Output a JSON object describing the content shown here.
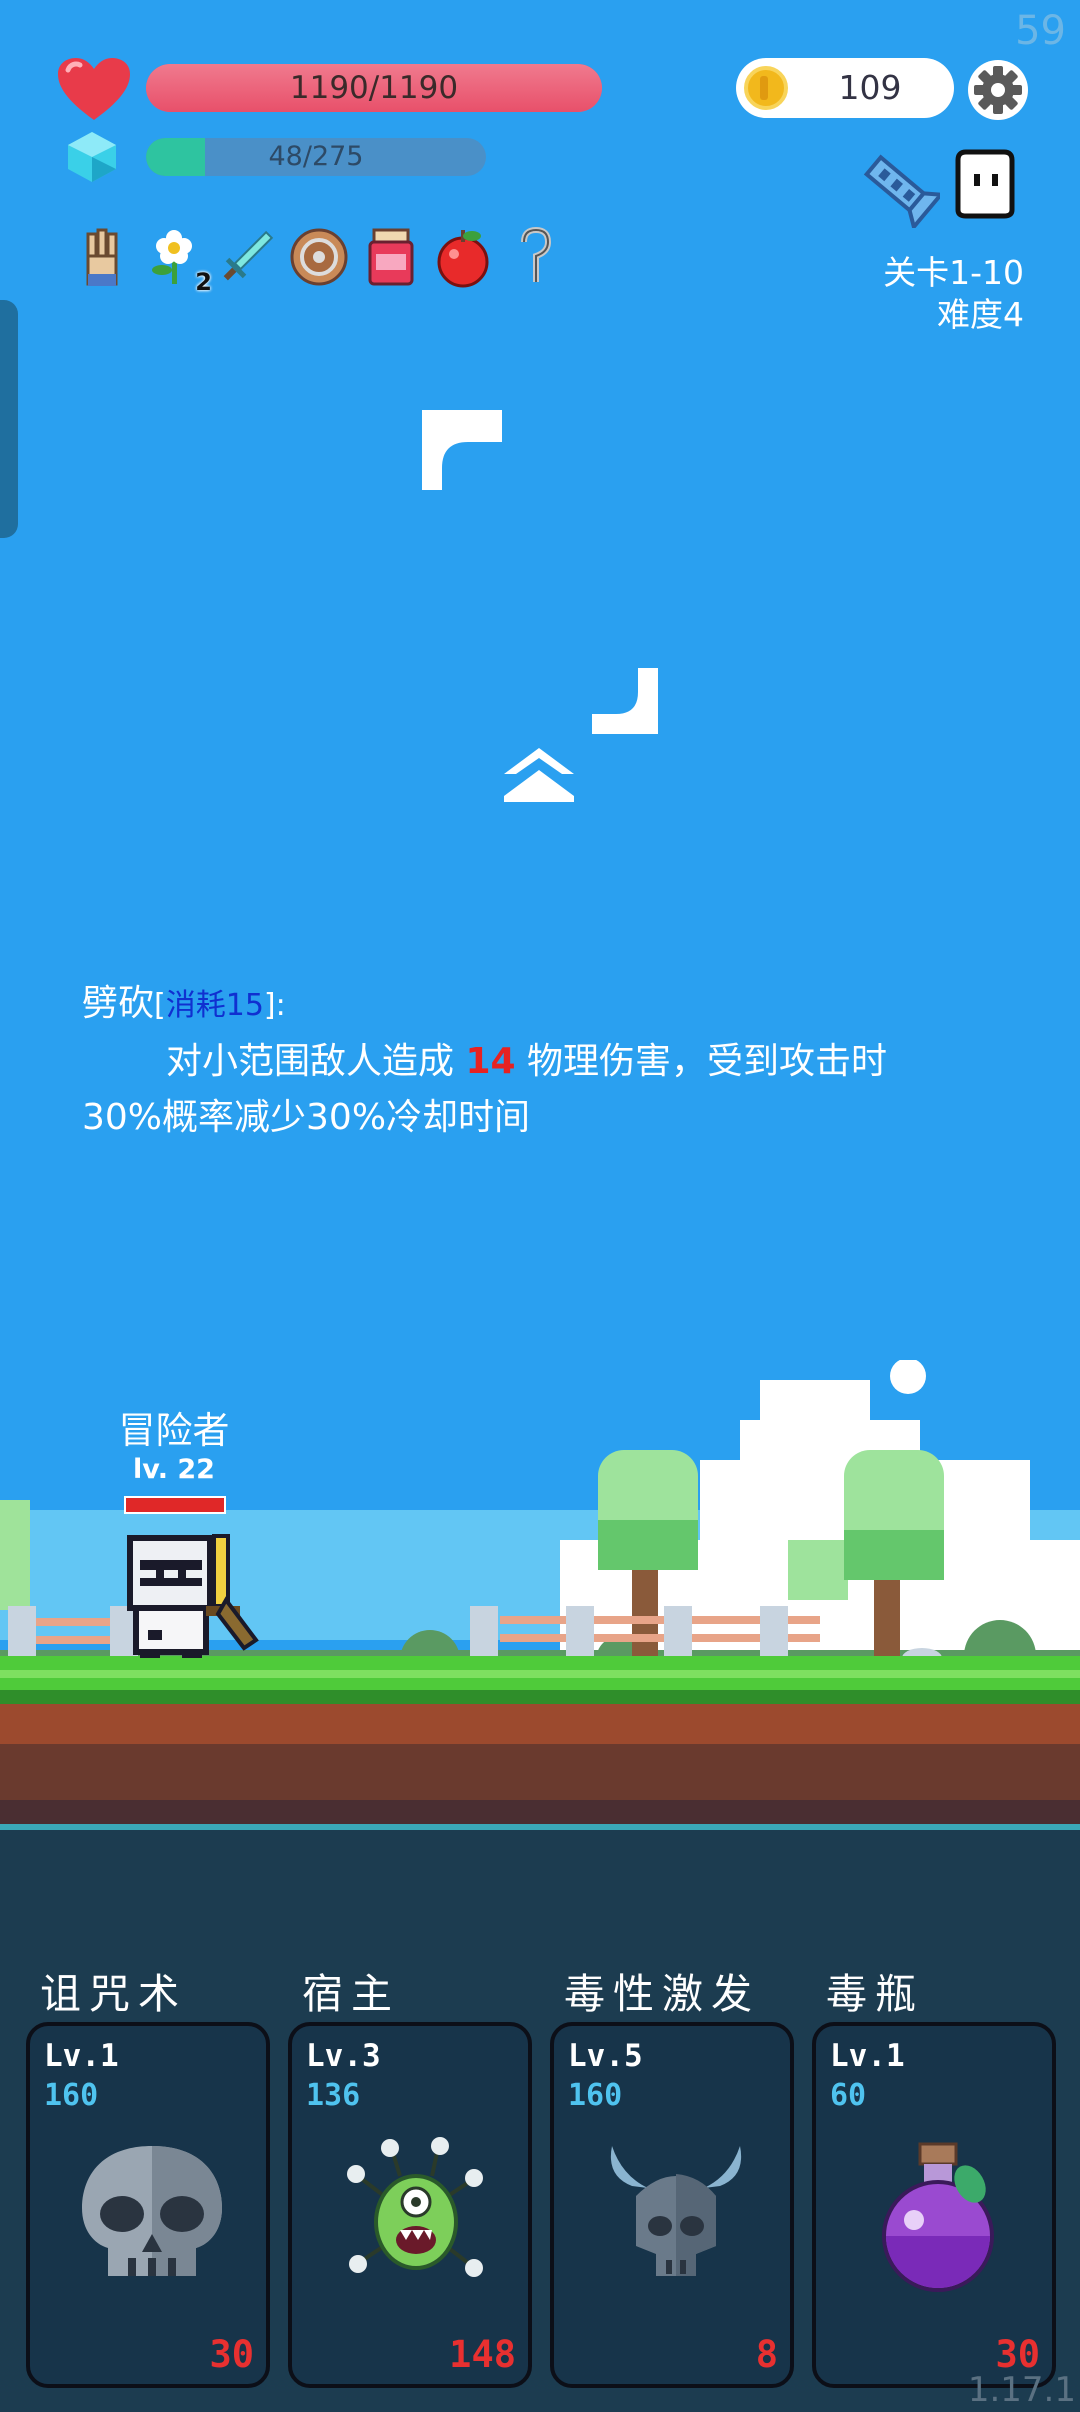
{
  "hud": {
    "fps": "59",
    "hp_text": "1190/1190",
    "hp_fraction": 1.0,
    "mp_text": "48/275",
    "mp_fraction": 0.1745,
    "coins": "109",
    "stage": "关卡1-10",
    "difficulty": "难度4",
    "items": [
      {
        "icon": "gauntlet-icon"
      },
      {
        "icon": "flower-icon",
        "count": "2"
      },
      {
        "icon": "sword-icon"
      },
      {
        "icon": "shield-icon"
      },
      {
        "icon": "jam-jar-icon"
      },
      {
        "icon": "apple-icon"
      },
      {
        "icon": "hook-icon"
      }
    ]
  },
  "skill_description": {
    "name": "劈砍",
    "bracket_open": "[",
    "cost": "消耗15",
    "bracket_close": "]:",
    "line1_before": "对小范围敌人造成 ",
    "damage": "14",
    "line1_after": " 物理伤害，受到攻击时",
    "line2": "30%概率减少30%冷却时间"
  },
  "hero": {
    "name": "冒险者",
    "level": "lv. 22",
    "hp_fraction": 1.0
  },
  "skills": [
    {
      "title": "诅咒术",
      "level": "Lv.1",
      "cost": "160",
      "damage": "30",
      "icon": "skull-icon"
    },
    {
      "title": "宿主",
      "level": "Lv.3",
      "cost": "136",
      "damage": "148",
      "icon": "green-monster-icon"
    },
    {
      "title": "毒性激发",
      "level": "Lv.5",
      "cost": "160",
      "damage": "8",
      "icon": "horned-helmet-icon"
    },
    {
      "title": "毒瓶",
      "level": "Lv.1",
      "cost": "60",
      "damage": "30",
      "icon": "poison-flask-icon"
    }
  ],
  "version": "1.17.1",
  "colors": {
    "sky": "#2aa0f0",
    "hp": "#e8506a",
    "mana": "#2ec4a0",
    "damage": "#e62222",
    "cost_blue": "#1030d0",
    "card_cost": "#4fc3ef"
  }
}
